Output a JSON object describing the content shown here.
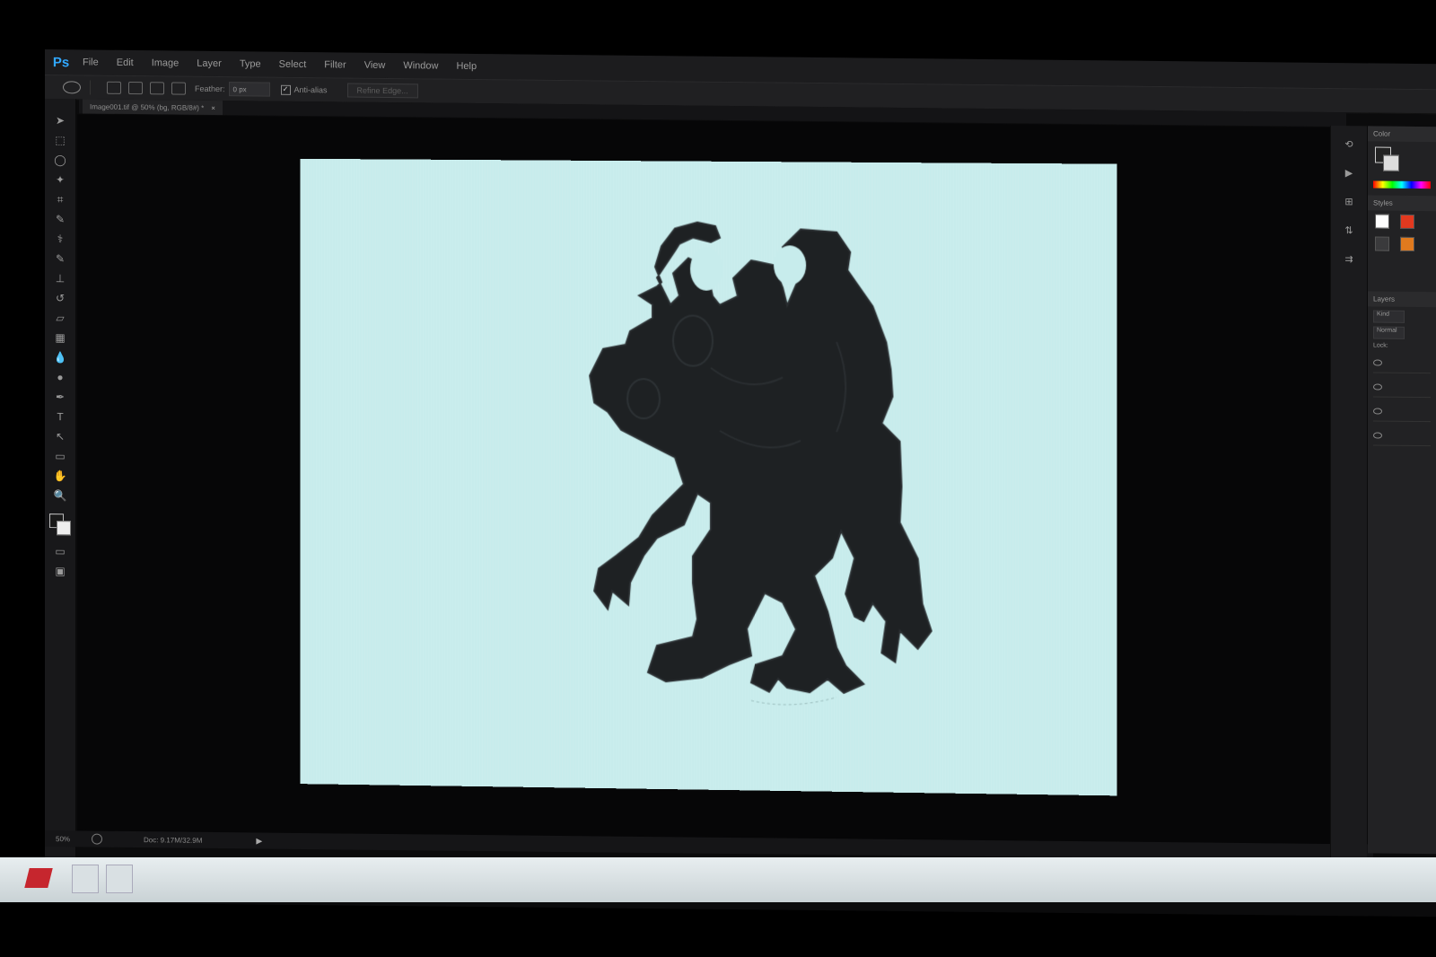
{
  "app": {
    "logo": "Ps",
    "menu": [
      "File",
      "Edit",
      "Image",
      "Layer",
      "Type",
      "Select",
      "Filter",
      "View",
      "Window",
      "Help"
    ]
  },
  "options": {
    "feather_label": "Feather:",
    "feather_value": "0 px",
    "antialias_label": "Anti-alias",
    "refine_label": "Refine Edge..."
  },
  "document": {
    "tab_title": "Image001.tif @ 50% (bg, RGB/8#) *",
    "close_glyph": "×"
  },
  "status": {
    "zoom": "50%",
    "doc_size": "Doc: 9.17M/32.9M",
    "arrow": "▶"
  },
  "panels": {
    "color_tab": "Color",
    "styles_tab": "Styles",
    "layers_tab": "Layers",
    "kind_field": "Kind",
    "normal_field": "Normal",
    "lock_label": "Lock:"
  },
  "colors": {
    "canvas": "#c7ecec",
    "silhouette": "#1e2123",
    "accent": "#31a8ff"
  },
  "icons": {
    "toolbar": [
      "move-icon",
      "marquee-icon",
      "lasso-icon",
      "quick-select-icon",
      "crop-icon",
      "eyedropper-icon",
      "healing-icon",
      "brush-icon",
      "stamp-icon",
      "history-brush-icon",
      "eraser-icon",
      "gradient-icon",
      "blur-icon",
      "dodge-icon",
      "pen-icon",
      "type-icon",
      "path-select-icon",
      "shape-icon",
      "hand-icon",
      "zoom-icon"
    ],
    "toolbar_glyphs": [
      "➤",
      "⬚",
      "◯",
      "✦",
      "⌗",
      "✎",
      "⚕",
      "✎",
      "⊥",
      "↺",
      "▱",
      "▦",
      "💧",
      "●",
      "✒",
      "T",
      "↖",
      "▭",
      "✋",
      "🔍"
    ],
    "dock": [
      "history-icon",
      "actions-icon",
      "properties-icon",
      "adjust-icon",
      "align-icon"
    ],
    "dock_glyphs": [
      "⟲",
      "▶",
      "⊞",
      "⇅",
      "⇉"
    ]
  }
}
